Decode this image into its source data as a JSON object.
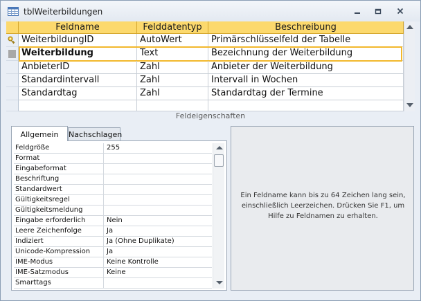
{
  "window": {
    "title": "tblWeiterbildungen",
    "icon": "table-icon",
    "controls": [
      "minimize-icon",
      "restore-icon",
      "close-icon"
    ]
  },
  "table_design": {
    "columns": [
      "Feldname",
      "Felddatentyp",
      "Beschreibung"
    ],
    "rows": [
      {
        "name": "WeiterbildungID",
        "type": "AutoWert",
        "description": "Primärschlüsselfeld der Tabelle",
        "primary_key": true,
        "selected": false
      },
      {
        "name": "Weiterbildung",
        "type": "Text",
        "description": "Bezeichnung der Weiterbildung",
        "primary_key": false,
        "selected": true
      },
      {
        "name": "AnbieterID",
        "type": "Zahl",
        "description": "Anbieter der Weiterbildung",
        "primary_key": false,
        "selected": false
      },
      {
        "name": "Standardintervall",
        "type": "Zahl",
        "description": "Intervall in Wochen",
        "primary_key": false,
        "selected": false
      },
      {
        "name": "Standardtag",
        "type": "Zahl",
        "description": "Standardtag der Termine",
        "primary_key": false,
        "selected": false
      },
      {
        "name": "",
        "type": "",
        "description": "",
        "primary_key": false,
        "selected": false
      }
    ]
  },
  "separator_label": "Feldeigenschaften",
  "property_tabs": [
    {
      "label": "Allgemein",
      "active": true
    },
    {
      "label": "Nachschlagen",
      "active": false
    }
  ],
  "properties": [
    {
      "label": "Feldgröße",
      "value": "255"
    },
    {
      "label": "Format",
      "value": ""
    },
    {
      "label": "Eingabeformat",
      "value": ""
    },
    {
      "label": "Beschriftung",
      "value": ""
    },
    {
      "label": "Standardwert",
      "value": ""
    },
    {
      "label": "Gültigkeitsregel",
      "value": ""
    },
    {
      "label": "Gültigkeitsmeldung",
      "value": ""
    },
    {
      "label": "Eingabe erforderlich",
      "value": "Nein"
    },
    {
      "label": "Leere Zeichenfolge",
      "value": "Ja"
    },
    {
      "label": "Indiziert",
      "value": "Ja (Ohne Duplikate)"
    },
    {
      "label": "Unicode-Kompression",
      "value": "Ja"
    },
    {
      "label": "IME-Modus",
      "value": "Keine Kontrolle"
    },
    {
      "label": "IME-Satzmodus",
      "value": "Keine"
    },
    {
      "label": "Smarttags",
      "value": ""
    }
  ],
  "help_text": "Ein Feldname kann bis zu 64 Zeichen lang sein, einschließlich Leerzeichen. Drücken Sie F1, um Hilfe zu Feldnamen zu erhalten.",
  "colors": {
    "header_fill": "#fcd96d",
    "selected_border": "#f2b82c",
    "window_bg": "#e9eef5"
  }
}
